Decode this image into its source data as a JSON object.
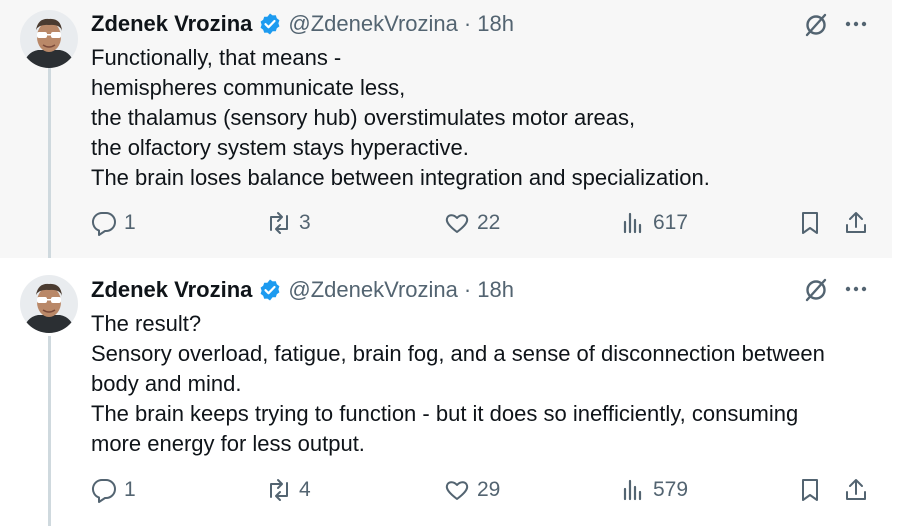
{
  "tweets": [
    {
      "author_name": "Zdenek Vrozina",
      "handle": "@ZdenekVrozina",
      "separator": "·",
      "time": "18h",
      "lines": [
        "Functionally, that means -",
        "hemispheres communicate less,",
        "the thalamus (sensory hub) overstimulates motor areas,",
        "the olfactory system stays hyperactive.",
        "The brain loses balance between integration and specialization."
      ],
      "stats": {
        "replies": "1",
        "reposts": "3",
        "likes": "22",
        "views": "617"
      }
    },
    {
      "author_name": "Zdenek Vrozina",
      "handle": "@ZdenekVrozina",
      "separator": "·",
      "time": "18h",
      "lines": [
        "The result?",
        "Sensory overload, fatigue, brain fog, and a sense of disconnection between",
        "body and mind.",
        "The brain keeps trying to function - but it does so inefficiently, consuming",
        "more energy for less output."
      ],
      "stats": {
        "replies": "1",
        "reposts": "4",
        "likes": "29",
        "views": "579"
      }
    }
  ],
  "colors": {
    "verified": "#1d9bf0",
    "muted": "#536471",
    "thread_line": "#cfd9de",
    "text": "#0f1419"
  },
  "icons": [
    "verified-badge-icon",
    "grok-icon",
    "more-icon",
    "reply-icon",
    "repost-icon",
    "like-icon",
    "views-icon",
    "bookmark-icon",
    "share-icon"
  ]
}
